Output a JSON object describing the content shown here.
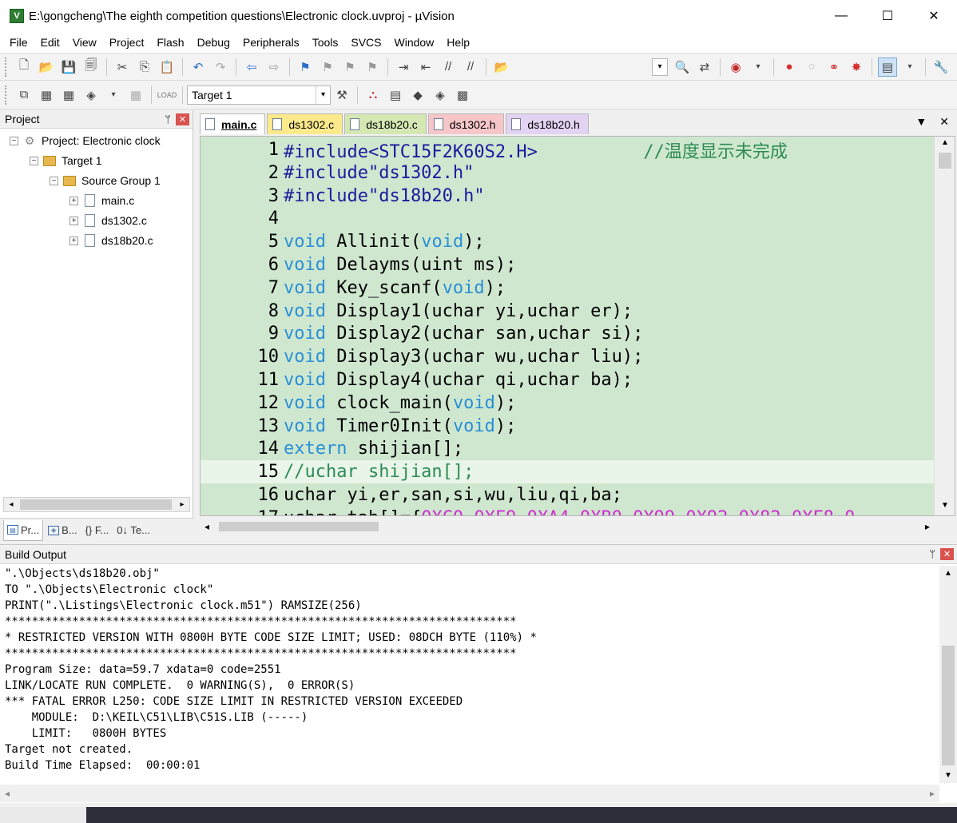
{
  "window": {
    "title": "E:\\gongcheng\\The eighth competition questions\\Electronic clock.uvproj - µVision",
    "app_icon_letter": "V",
    "controls": [
      "—",
      "☐",
      "✕"
    ]
  },
  "menu": [
    "File",
    "Edit",
    "View",
    "Project",
    "Flash",
    "Debug",
    "Peripherals",
    "Tools",
    "SVCS",
    "Window",
    "Help"
  ],
  "toolbar2": {
    "target": "Target 1"
  },
  "project_panel": {
    "title": "Project",
    "pin": "ᛘ",
    "close": "✕",
    "tree": {
      "project": "Project: Electronic clock",
      "target": "Target 1",
      "group": "Source Group 1",
      "files": [
        "main.c",
        "ds1302.c",
        "ds18b20.c"
      ]
    },
    "bottom_tabs": [
      "Pr...",
      "B...",
      "{} F...",
      "0↓ Te..."
    ]
  },
  "editor": {
    "tabs": [
      {
        "label": "main.c",
        "style": "active"
      },
      {
        "label": "ds1302.c",
        "style": "yellow"
      },
      {
        "label": "ds18b20.c",
        "style": "green"
      },
      {
        "label": "ds1302.h",
        "style": "pink"
      },
      {
        "label": "ds18b20.h",
        "style": "purple"
      }
    ],
    "lines": [
      {
        "n": "1",
        "text": "#include<STC15F2K60S2.H>          //温度显示未完成"
      },
      {
        "n": "2",
        "text": "#include\"ds1302.h\""
      },
      {
        "n": "3",
        "text": "#include\"ds18b20.h\""
      },
      {
        "n": "4",
        "text": ""
      },
      {
        "n": "5",
        "text": "void Allinit(void);"
      },
      {
        "n": "6",
        "text": "void Delayms(uint ms);"
      },
      {
        "n": "7",
        "text": "void Key_scanf(void);"
      },
      {
        "n": "8",
        "text": "void Display1(uchar yi,uchar er);"
      },
      {
        "n": "9",
        "text": "void Display2(uchar san,uchar si);"
      },
      {
        "n": "10",
        "text": "void Display3(uchar wu,uchar liu);"
      },
      {
        "n": "11",
        "text": "void Display4(uchar qi,uchar ba);"
      },
      {
        "n": "12",
        "text": "void clock_main(void);"
      },
      {
        "n": "13",
        "text": "void Timer0Init(void);"
      },
      {
        "n": "14",
        "text": "extern shijian[];"
      },
      {
        "n": "15",
        "text": "//uchar shijian[];"
      },
      {
        "n": "16",
        "text": "uchar yi,er,san,si,wu,liu,qi,ba;"
      },
      {
        "n": "17",
        "text": "uchar tab[]={0XC0,0XF9,0XA4,0XB0,0X99,0X92,0X82,0XF8,0"
      }
    ],
    "highlighted_line": "15"
  },
  "build_output": {
    "title": "Build Output",
    "lines": [
      "\".\\Objects\\ds18b20.obj\"",
      "TO \".\\Objects\\Electronic clock\"",
      "PRINT(\".\\Listings\\Electronic clock.m51\") RAMSIZE(256)",
      "****************************************************************************",
      "* RESTRICTED VERSION WITH 0800H BYTE CODE SIZE LIMIT; USED: 08DCH BYTE (110%) *",
      "****************************************************************************",
      "Program Size: data=59.7 xdata=0 code=2551",
      "LINK/LOCATE RUN COMPLETE.  0 WARNING(S),  0 ERROR(S)",
      "*** FATAL ERROR L250: CODE SIZE LIMIT IN RESTRICTED VERSION EXCEEDED",
      "    MODULE:  D:\\KEIL\\C51\\LIB\\C51S.LIB (-----)",
      "    LIMIT:   0800H BYTES",
      "Target not created.",
      "Build Time Elapsed:  00:00:01"
    ]
  },
  "colors": {
    "code_bg": "#cfe7cf",
    "keyword": "#2a8fd6",
    "comment": "#2e8b57",
    "hex_literal": "#d22bd2"
  }
}
